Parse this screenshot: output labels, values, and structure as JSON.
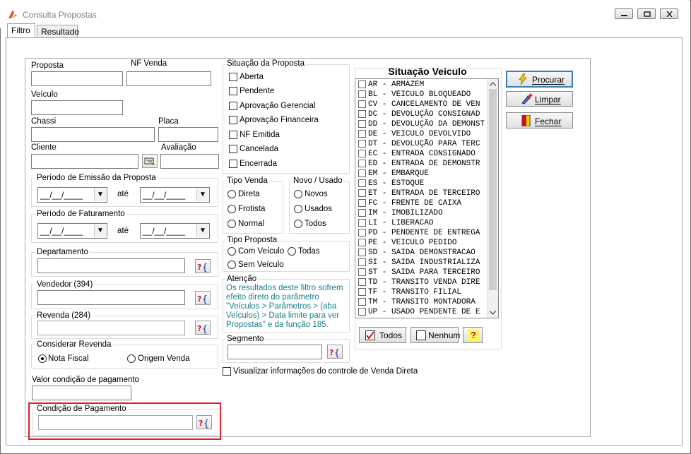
{
  "window": {
    "title": "Consulta Propostas"
  },
  "tabs": [
    {
      "label": "Filtro"
    },
    {
      "label": "Resultado"
    }
  ],
  "fields": {
    "proposta": "Proposta",
    "nf_venda": "NF Venda",
    "veiculo": "Veículo",
    "chassi": "Chassi",
    "placa": "Placa",
    "cliente": "Cliente",
    "avaliacao": "Avaliação",
    "valor_condicao": "Valor condição de pagamento"
  },
  "periodo_emissao": {
    "title": "Período de Emissão da Proposta",
    "from": "__/__/____",
    "ate": "até",
    "to": "__/__/____"
  },
  "periodo_faturamento": {
    "title": "Período de Faturamento",
    "from": "__/__/____",
    "ate": "até",
    "to": "__/__/____"
  },
  "departamento": {
    "title": "Departamento"
  },
  "vendedor": {
    "title": "Vendedor (394)"
  },
  "revenda": {
    "title": "Revenda (284)"
  },
  "considerar_revenda": {
    "title": "Considerar Revenda",
    "options": [
      "Nota Fiscal",
      "Origem Venda"
    ],
    "selected": "Nota Fiscal"
  },
  "condicao_pagamento": {
    "title": "Condição de Pagamento"
  },
  "situacao_proposta": {
    "title": "Situação da Proposta",
    "items": [
      "Aberta",
      "Pendente",
      "Aprovação Gerencial",
      "Aprovação Financeira",
      "NF Emitida",
      "Cancelada",
      "Encerrada"
    ]
  },
  "tipo_venda": {
    "title": "Tipo Venda",
    "options": [
      "Direta",
      "Frotista",
      "Normal"
    ]
  },
  "novo_usado": {
    "title": "Novo / Usado",
    "options": [
      "Novos",
      "Usados",
      "Todos"
    ]
  },
  "tipo_proposta": {
    "title": "Tipo Proposta",
    "options": [
      "Com Veículo",
      "Todas",
      "Sem Veículo"
    ]
  },
  "atencao": {
    "title": "Atenção",
    "lines": [
      "Os resultados deste filtro sofrem",
      "efeito direto do parâmetro",
      "\"Veículos > Parâmetros > (aba",
      "Veículos) > Data limite para ver",
      "Propostas\" e da função 185."
    ]
  },
  "segmento": {
    "title": "Segmento"
  },
  "visualizar_venda_direta": "Visualizar informações do controle de Venda Direta",
  "situacao_veiculo": {
    "title": "Situação Veículo",
    "items": [
      "AR - ARMAZEM",
      "BL - VEICULO BLOQUEADO",
      "CV - CANCELAMENTO DE VEN",
      "DC - DEVOLUÇÃO CONSIGNAD",
      "DD - DEVOLUÇÃO DA DEMONST",
      "DE - VEICULO DEVOLVIDO",
      "DT - DEVOLUÇÃO PARA TERC",
      "EC - ENTRADA CONSIGNADO",
      "ED - ENTRADA DE DEMONSTR",
      "EM - EMBARQUE",
      "ES - ESTOQUE",
      "ET - ENTRADA DE TERCEIRO",
      "FC - FRENTE DE CAIXA",
      "IM - IMOBILIZADO",
      "LI - LIBERACAO",
      "PD - PENDENTE DE ENTREGA",
      "PE - VEICULO PEDIDO",
      "SD - SAIDA DEMONSTRACAO",
      "SI - SAIDA INDUSTRIALIZA",
      "ST - SAIDA PARA TERCEIRO",
      "TD - TRANSITO VENDA DIRE",
      "TF - TRANSITO FILIAL",
      "TM - TRANSITO MONTADORA",
      "UP - USADO PENDENTE DE E"
    ],
    "btn_todos": "Todos",
    "btn_nenhum": "Nenhum",
    "btn_help": "?"
  },
  "actions": {
    "procurar": "Procurar",
    "limpar": "Limpar",
    "fechar": "Fechar"
  },
  "colors": {
    "accent": "#3c7fb1",
    "highlight": "#e0202a",
    "attention": "#1a7f8c"
  }
}
